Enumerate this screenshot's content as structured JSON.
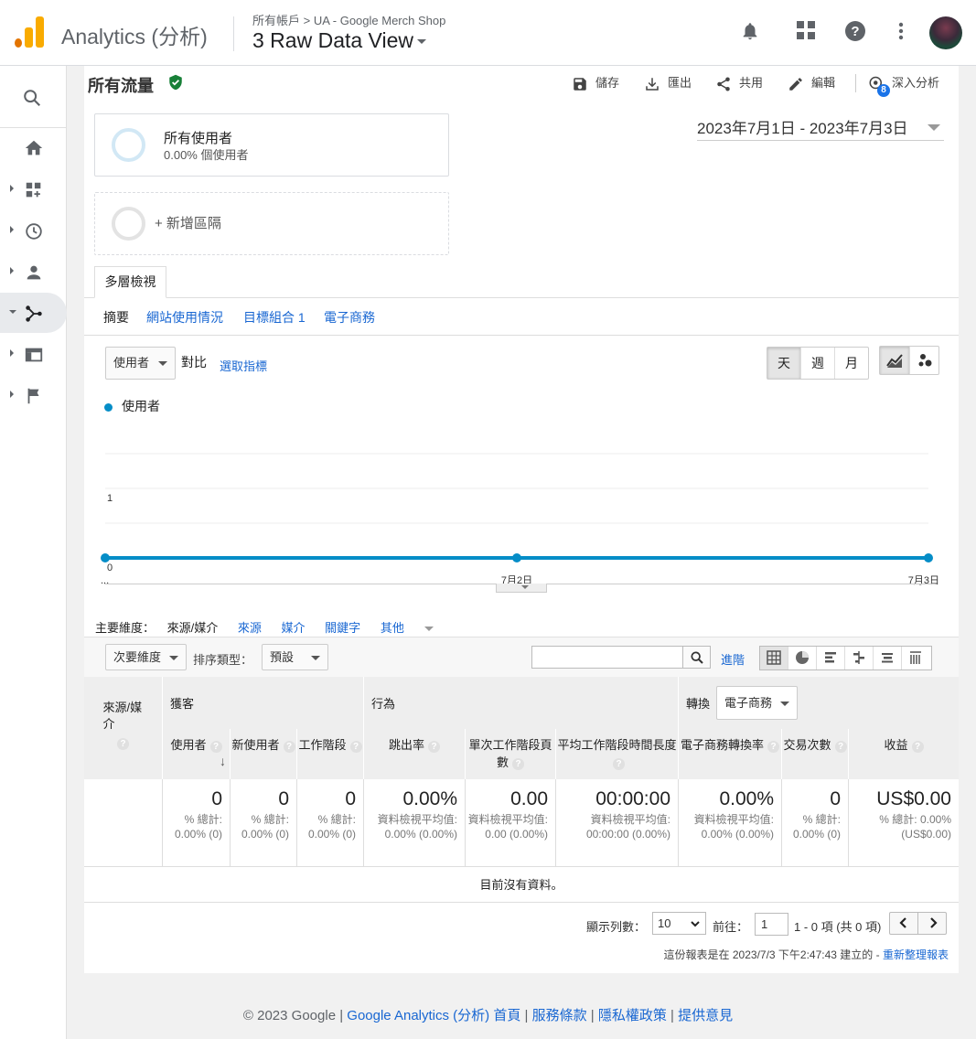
{
  "header": {
    "product": "Analytics (分析)",
    "breadcrumb": "所有帳戶 > UA - Google Merch Shop",
    "view_name": "3 Raw Data View"
  },
  "toolbar": {
    "segment_title": "所有流量",
    "save": "儲存",
    "export": "匯出",
    "share": "共用",
    "edit": "編輯",
    "insights": "深入分析",
    "insights_badge": "8"
  },
  "segments": {
    "all_users_title": "所有使用者",
    "all_users_sub": "0.00% 個使用者",
    "add_segment": "+ 新增區隔"
  },
  "date_range": "2023年7月1日 - 2023年7月3日",
  "tabs": {
    "explorer": "多層檢視",
    "subtabs": [
      "摘要",
      "網站使用情況",
      "目標組合 1",
      "電子商務"
    ]
  },
  "chart_controls": {
    "metric": "使用者",
    "compare": "對比",
    "select_metric": "選取指標",
    "periods": [
      "天",
      "週",
      "月"
    ]
  },
  "chart_data": {
    "type": "line",
    "series": [
      {
        "name": "使用者",
        "values": [
          0,
          0,
          0
        ]
      }
    ],
    "x": [
      "...",
      "7月2日",
      "7月3日"
    ],
    "y_ticks": [
      "1",
      "0"
    ],
    "ylim": [
      0,
      1
    ],
    "color": "#058dc7"
  },
  "dimensions": {
    "label": "主要維度：",
    "current": "來源/媒介",
    "options": [
      "來源",
      "媒介",
      "關鍵字",
      "其他"
    ]
  },
  "table_controls": {
    "secondary_dim": "次要維度",
    "sort_label": "排序類型：",
    "sort_value": "預設",
    "advanced": "進階"
  },
  "table": {
    "dim_header": "來源/媒介",
    "groups": {
      "acquisition": "獲客",
      "behavior": "行為",
      "conversion": "轉換",
      "conversion_select": "電子商務"
    },
    "columns": [
      "使用者",
      "新使用者",
      "工作階段",
      "跳出率",
      "單次工作階段頁數",
      "平均工作階段時間長度",
      "電子商務轉換率",
      "交易次數",
      "收益"
    ],
    "totals": [
      {
        "value": "0",
        "sub": "% 總計: 0.00% (0)"
      },
      {
        "value": "0",
        "sub": "% 總計: 0.00% (0)"
      },
      {
        "value": "0",
        "sub": "% 總計: 0.00% (0)"
      },
      {
        "value": "0.00%",
        "sub": "資料檢視平均值: 0.00% (0.00%)"
      },
      {
        "value": "0.00",
        "sub": "資料檢視平均值: 0.00 (0.00%)"
      },
      {
        "value": "00:00:00",
        "sub": "資料檢視平均值: 00:00:00 (0.00%)"
      },
      {
        "value": "0.00%",
        "sub": "資料檢視平均值: 0.00% (0.00%)"
      },
      {
        "value": "0",
        "sub": "% 總計: 0.00% (0)"
      },
      {
        "value": "US$0.00",
        "sub": "% 總計: 0.00% (US$0.00)"
      }
    ],
    "no_data": "目前沒有資料。"
  },
  "pager": {
    "rows_label": "顯示列數：",
    "rows_value": "10",
    "goto_label": "前往：",
    "goto_value": "1",
    "range": "1 - 0 項 (共 0 項)"
  },
  "report_note": "這份報表是在 2023/7/3 下午2:47:43 建立的 -",
  "refresh_link": "重新整理報表",
  "footer": {
    "copyright": "© 2023 Google",
    "links": [
      "Google Analytics (分析) 首頁",
      "服務條款",
      "隱私權政策",
      "提供意見"
    ]
  }
}
